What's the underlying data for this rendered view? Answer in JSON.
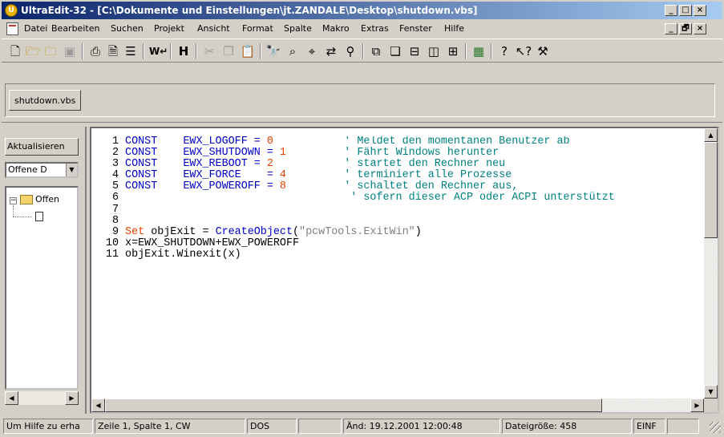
{
  "window": {
    "title": "UltraEdit-32 - [C:\\Dokumente und Einstellungen\\jt.ZANDALE\\Desktop\\shutdown.vbs]",
    "app_icon": "ultraedit-icon",
    "controls": [
      "_",
      "□",
      "×"
    ],
    "mdi_controls": [
      "_",
      "🗗",
      "×"
    ]
  },
  "menu": {
    "items": [
      "Datei",
      "Bearbeiten",
      "Suchen",
      "Projekt",
      "Ansicht",
      "Format",
      "Spalte",
      "Makro",
      "Extras",
      "Fenster",
      "Hilfe"
    ]
  },
  "toolbar": {
    "icons": [
      "new-file-icon",
      "open-icon",
      "open-folder-icon",
      "save-icon",
      "print-icon",
      "print-preview-icon",
      "page-setup-icon",
      "word-wrap-icon",
      "hex-mode-icon",
      "cut-icon",
      "copy-icon",
      "paste-icon",
      "find-icon",
      "find-next-icon",
      "find-prev-icon",
      "replace-icon",
      "find-in-files-icon",
      "tile-icon",
      "cascade-icon",
      "split-h-icon",
      "split-v-icon",
      "column-icon",
      "mark-icon",
      "help-icon",
      "context-help-icon",
      "tools-icon"
    ]
  },
  "tabs": [
    {
      "label": "shutdown.vbs"
    }
  ],
  "sidebar": {
    "refresh_button": "Aktualisieren",
    "filter_value": "Offene D",
    "tree_root": "Offen"
  },
  "editor": {
    "lines": [
      {
        "n": "1",
        "parts": [
          [
            "kw",
            "CONST    "
          ],
          [
            "kw",
            "EWX_LOGOFF = "
          ],
          [
            "num",
            "0"
          ],
          [
            "",
            "           "
          ],
          [
            "cmt",
            "' Meldet den momentanen Benutzer ab"
          ]
        ]
      },
      {
        "n": "2",
        "parts": [
          [
            "kw",
            "CONST    "
          ],
          [
            "kw",
            "EWX_SHUTDOWN = "
          ],
          [
            "num",
            "1"
          ],
          [
            "",
            "         "
          ],
          [
            "cmt",
            "' Fährt Windows herunter"
          ]
        ]
      },
      {
        "n": "3",
        "parts": [
          [
            "kw",
            "CONST    "
          ],
          [
            "kw",
            "EWX_REBOOT = "
          ],
          [
            "num",
            "2"
          ],
          [
            "",
            "           "
          ],
          [
            "cmt",
            "' startet den Rechner neu"
          ]
        ]
      },
      {
        "n": "4",
        "parts": [
          [
            "kw",
            "CONST    "
          ],
          [
            "kw",
            "EWX_FORCE    = "
          ],
          [
            "num",
            "4"
          ],
          [
            "",
            "         "
          ],
          [
            "cmt",
            "' terminiert alle Prozesse"
          ]
        ]
      },
      {
        "n": "5",
        "parts": [
          [
            "kw",
            "CONST    "
          ],
          [
            "kw",
            "EWX_POWEROFF = "
          ],
          [
            "num",
            "8"
          ],
          [
            "",
            "         "
          ],
          [
            "cmt",
            "' schaltet den Rechner aus,"
          ]
        ]
      },
      {
        "n": "6",
        "parts": [
          [
            "",
            "                                   "
          ],
          [
            "cmt",
            "' sofern dieser ACP oder ACPI unterstützt"
          ]
        ]
      },
      {
        "n": "7",
        "parts": []
      },
      {
        "n": "8",
        "parts": []
      },
      {
        "n": "9",
        "parts": [
          [
            "set",
            "Set"
          ],
          [
            "",
            " objExit = "
          ],
          [
            "fn",
            "CreateObject"
          ],
          [
            "",
            "("
          ],
          [
            "str",
            "\"pcwTools.ExitWin\""
          ],
          [
            "",
            ")"
          ]
        ]
      },
      {
        "n": "10",
        "parts": [
          [
            "",
            "x=EWX_SHUTDOWN+EWX_POWEROFF"
          ]
        ]
      },
      {
        "n": "11",
        "parts": [
          [
            "",
            "objExit.Winexit(x)"
          ]
        ]
      }
    ]
  },
  "status": {
    "help": "Um Hilfe zu erha",
    "position": "Zeile 1, Spalte 1, CW",
    "format": "DOS",
    "modified": "Änd: 19.12.2001 12:00:48",
    "size": "Dateigröße: 458",
    "mode": "EINF"
  }
}
